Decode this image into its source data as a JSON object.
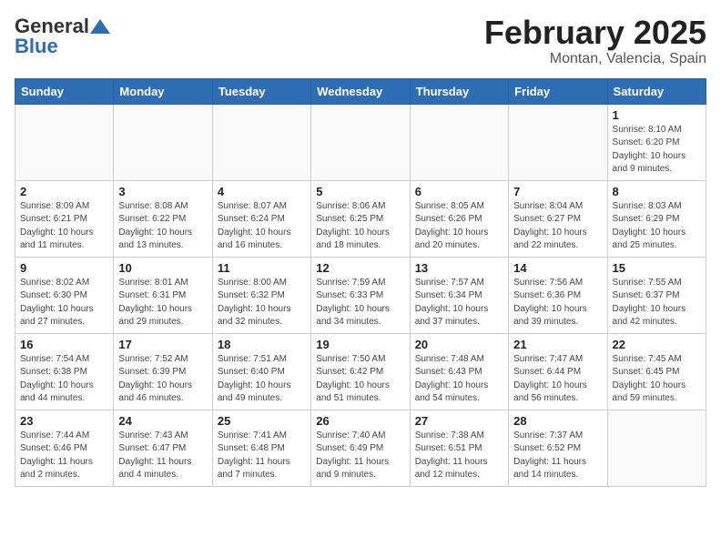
{
  "header": {
    "logo_general": "General",
    "logo_blue": "Blue",
    "month_title": "February 2025",
    "location": "Montan, Valencia, Spain"
  },
  "days_of_week": [
    "Sunday",
    "Monday",
    "Tuesday",
    "Wednesday",
    "Thursday",
    "Friday",
    "Saturday"
  ],
  "weeks": [
    [
      {
        "day": "",
        "info": ""
      },
      {
        "day": "",
        "info": ""
      },
      {
        "day": "",
        "info": ""
      },
      {
        "day": "",
        "info": ""
      },
      {
        "day": "",
        "info": ""
      },
      {
        "day": "",
        "info": ""
      },
      {
        "day": "1",
        "info": "Sunrise: 8:10 AM\nSunset: 6:20 PM\nDaylight: 10 hours\nand 9 minutes."
      }
    ],
    [
      {
        "day": "2",
        "info": "Sunrise: 8:09 AM\nSunset: 6:21 PM\nDaylight: 10 hours\nand 11 minutes."
      },
      {
        "day": "3",
        "info": "Sunrise: 8:08 AM\nSunset: 6:22 PM\nDaylight: 10 hours\nand 13 minutes."
      },
      {
        "day": "4",
        "info": "Sunrise: 8:07 AM\nSunset: 6:24 PM\nDaylight: 10 hours\nand 16 minutes."
      },
      {
        "day": "5",
        "info": "Sunrise: 8:06 AM\nSunset: 6:25 PM\nDaylight: 10 hours\nand 18 minutes."
      },
      {
        "day": "6",
        "info": "Sunrise: 8:05 AM\nSunset: 6:26 PM\nDaylight: 10 hours\nand 20 minutes."
      },
      {
        "day": "7",
        "info": "Sunrise: 8:04 AM\nSunset: 6:27 PM\nDaylight: 10 hours\nand 22 minutes."
      },
      {
        "day": "8",
        "info": "Sunrise: 8:03 AM\nSunset: 6:29 PM\nDaylight: 10 hours\nand 25 minutes."
      }
    ],
    [
      {
        "day": "9",
        "info": "Sunrise: 8:02 AM\nSunset: 6:30 PM\nDaylight: 10 hours\nand 27 minutes."
      },
      {
        "day": "10",
        "info": "Sunrise: 8:01 AM\nSunset: 6:31 PM\nDaylight: 10 hours\nand 29 minutes."
      },
      {
        "day": "11",
        "info": "Sunrise: 8:00 AM\nSunset: 6:32 PM\nDaylight: 10 hours\nand 32 minutes."
      },
      {
        "day": "12",
        "info": "Sunrise: 7:59 AM\nSunset: 6:33 PM\nDaylight: 10 hours\nand 34 minutes."
      },
      {
        "day": "13",
        "info": "Sunrise: 7:57 AM\nSunset: 6:34 PM\nDaylight: 10 hours\nand 37 minutes."
      },
      {
        "day": "14",
        "info": "Sunrise: 7:56 AM\nSunset: 6:36 PM\nDaylight: 10 hours\nand 39 minutes."
      },
      {
        "day": "15",
        "info": "Sunrise: 7:55 AM\nSunset: 6:37 PM\nDaylight: 10 hours\nand 42 minutes."
      }
    ],
    [
      {
        "day": "16",
        "info": "Sunrise: 7:54 AM\nSunset: 6:38 PM\nDaylight: 10 hours\nand 44 minutes."
      },
      {
        "day": "17",
        "info": "Sunrise: 7:52 AM\nSunset: 6:39 PM\nDaylight: 10 hours\nand 46 minutes."
      },
      {
        "day": "18",
        "info": "Sunrise: 7:51 AM\nSunset: 6:40 PM\nDaylight: 10 hours\nand 49 minutes."
      },
      {
        "day": "19",
        "info": "Sunrise: 7:50 AM\nSunset: 6:42 PM\nDaylight: 10 hours\nand 51 minutes."
      },
      {
        "day": "20",
        "info": "Sunrise: 7:48 AM\nSunset: 6:43 PM\nDaylight: 10 hours\nand 54 minutes."
      },
      {
        "day": "21",
        "info": "Sunrise: 7:47 AM\nSunset: 6:44 PM\nDaylight: 10 hours\nand 56 minutes."
      },
      {
        "day": "22",
        "info": "Sunrise: 7:45 AM\nSunset: 6:45 PM\nDaylight: 10 hours\nand 59 minutes."
      }
    ],
    [
      {
        "day": "23",
        "info": "Sunrise: 7:44 AM\nSunset: 6:46 PM\nDaylight: 11 hours\nand 2 minutes."
      },
      {
        "day": "24",
        "info": "Sunrise: 7:43 AM\nSunset: 6:47 PM\nDaylight: 11 hours\nand 4 minutes."
      },
      {
        "day": "25",
        "info": "Sunrise: 7:41 AM\nSunset: 6:48 PM\nDaylight: 11 hours\nand 7 minutes."
      },
      {
        "day": "26",
        "info": "Sunrise: 7:40 AM\nSunset: 6:49 PM\nDaylight: 11 hours\nand 9 minutes."
      },
      {
        "day": "27",
        "info": "Sunrise: 7:38 AM\nSunset: 6:51 PM\nDaylight: 11 hours\nand 12 minutes."
      },
      {
        "day": "28",
        "info": "Sunrise: 7:37 AM\nSunset: 6:52 PM\nDaylight: 11 hours\nand 14 minutes."
      },
      {
        "day": "",
        "info": ""
      }
    ]
  ]
}
